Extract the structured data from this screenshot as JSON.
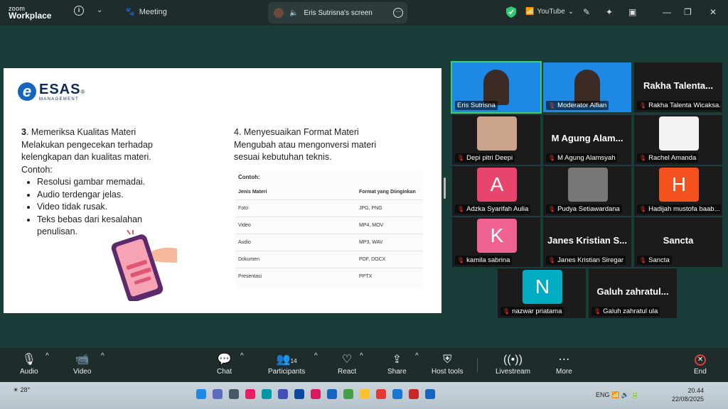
{
  "titlebar": {
    "brand_top": "zoom",
    "brand_bottom": "Workplace",
    "meeting_label": "Meeting",
    "share_tab_label": "Eris Sutrisna's screen",
    "livestream_label": "YouTube"
  },
  "slide": {
    "brand": "ESAS",
    "brand_sub": "MANAGEMENT",
    "left": {
      "num": "3",
      "heading": ". Memeriksa Kualitas Materi",
      "body": "Melakukan pengecekan terhadap kelengkapan dan kualitas materi.",
      "example": "Contoh:",
      "bullets": [
        "Resolusi gambar memadai.",
        "Audio terdengar jelas.",
        "Video tidak rusak.",
        "Teks bebas dari kesalahan penulisan."
      ]
    },
    "right": {
      "heading": "4. Menyesuaikan Format Materi",
      "body": "Mengubah atau mengonversi materi sesuai kebutuhan teknis."
    },
    "table": {
      "caption": "Contoh:",
      "headers": [
        "Jenis Materi",
        "Format yang Diinginkan"
      ],
      "rows": [
        [
          "Foto",
          "JPG, PNG"
        ],
        [
          "Video",
          "MP4, MOV"
        ],
        [
          "Audio",
          "MP3, WAV"
        ],
        [
          "Dokumen",
          "PDF, DOCX"
        ],
        [
          "Presentasi",
          "PPTX"
        ]
      ]
    }
  },
  "participants": [
    {
      "name": "Eris Sutrisna",
      "big": "",
      "avatar": "",
      "color": "#1e88e5"
    },
    {
      "name": "Moderator Alfian",
      "big": "",
      "avatar": "",
      "color": "#1e88e5"
    },
    {
      "name": "Rakha Talenta Wicaksa...",
      "big": "Rakha Talenta...",
      "avatar": "",
      "color": ""
    },
    {
      "name": "Depi pitri Deepi",
      "big": "",
      "avatar": "",
      "color": "#c9a48a"
    },
    {
      "name": "M Agung Alamsyah",
      "big": "M Agung Alam...",
      "avatar": "",
      "color": ""
    },
    {
      "name": "Rachel Amanda",
      "big": "",
      "avatar": "",
      "color": "#f2f2f2"
    },
    {
      "name": "Adzka Syarifah Aulia",
      "big": "",
      "avatar": "A",
      "color": "#e8456c"
    },
    {
      "name": "Pudya Setiawardana",
      "big": "",
      "avatar": "",
      "color": "#777777"
    },
    {
      "name": "Hadijah mustofa baab...",
      "big": "",
      "avatar": "H",
      "color": "#f4511e"
    },
    {
      "name": "kamila sabrina",
      "big": "",
      "avatar": "K",
      "color": "#f06292"
    },
    {
      "name": "Janes Kristian Siregar",
      "big": "Janes Kristian S...",
      "avatar": "",
      "color": ""
    },
    {
      "name": "Sancta",
      "big": "Sancta",
      "avatar": "",
      "color": ""
    },
    {
      "name": "nazwar priatama",
      "big": "",
      "avatar": "N",
      "color": "#00acc1"
    },
    {
      "name": "Galuh zahratul ula",
      "big": "Galuh zahratul...",
      "avatar": "",
      "color": ""
    }
  ],
  "toolbar": {
    "audio": "Audio",
    "video": "Video",
    "chat": "Chat",
    "participants": "Participants",
    "participants_count": "14",
    "react": "React",
    "share": "Share",
    "host_tools": "Host tools",
    "livestream": "Livestream",
    "more": "More",
    "end": "End"
  },
  "taskbar": {
    "temperature": "28°",
    "lang": "ENG",
    "time": "20.44",
    "date": "22/08/2025"
  }
}
